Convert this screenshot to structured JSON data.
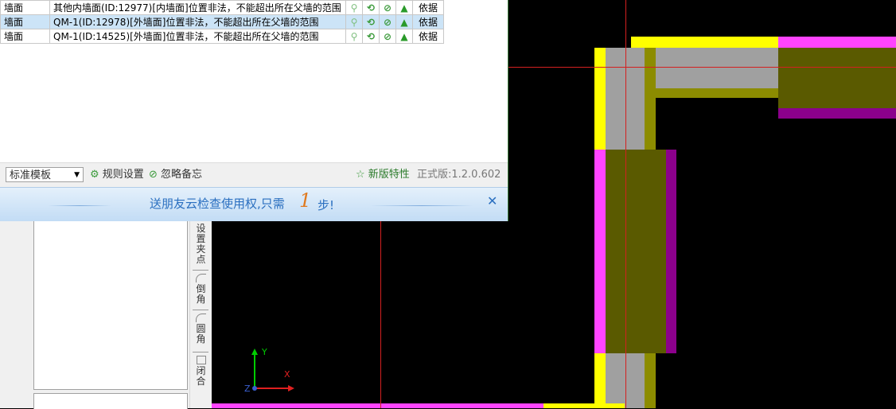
{
  "issues": {
    "rows": [
      {
        "type": "墙面",
        "message": "其他内墙面(ID:12977)[内墙面]位置非法，不能超出所在父墙的范围",
        "basis": "依据",
        "selected": false
      },
      {
        "type": "墙面",
        "message": "QM-1(ID:12978)[外墙面]位置非法，不能超出所在父墙的范围",
        "basis": "依据",
        "selected": true
      },
      {
        "type": "墙面",
        "message": "QM-1(ID:14525)[外墙面]位置非法，不能超出所在父墙的范围",
        "basis": "依据",
        "selected": false
      }
    ],
    "icons": [
      "bulb-icon",
      "refresh-icon",
      "ignore-icon",
      "thumbs-up-icon"
    ]
  },
  "statusbar": {
    "template": "标准模板",
    "rule_settings": "规则设置",
    "ignore_memo": "忽略备忘",
    "new_features": "新版特性",
    "version": "正式版:1.2.0.602"
  },
  "banner": {
    "text": "送朋友云检查使用权,只需",
    "number": "1",
    "suffix": "步!",
    "close": "✕"
  },
  "vtoolbar": {
    "set_grip": "设置夹点",
    "chamfer": "倒角",
    "fillet": "圆角",
    "close": "闭合"
  },
  "axes": {
    "x": "X",
    "y": "Y",
    "z": "Z"
  },
  "colors": {
    "yellow": "#ffff00",
    "magenta": "#ff44ff",
    "grey": "#a0a0a0",
    "olive": "#8c8c00",
    "dark_olive": "#5a5a00",
    "purple": "#8c008c",
    "crosshair": "#d42020",
    "accent_green": "#3a9a3a",
    "banner_blue": "#2a6fc0"
  }
}
